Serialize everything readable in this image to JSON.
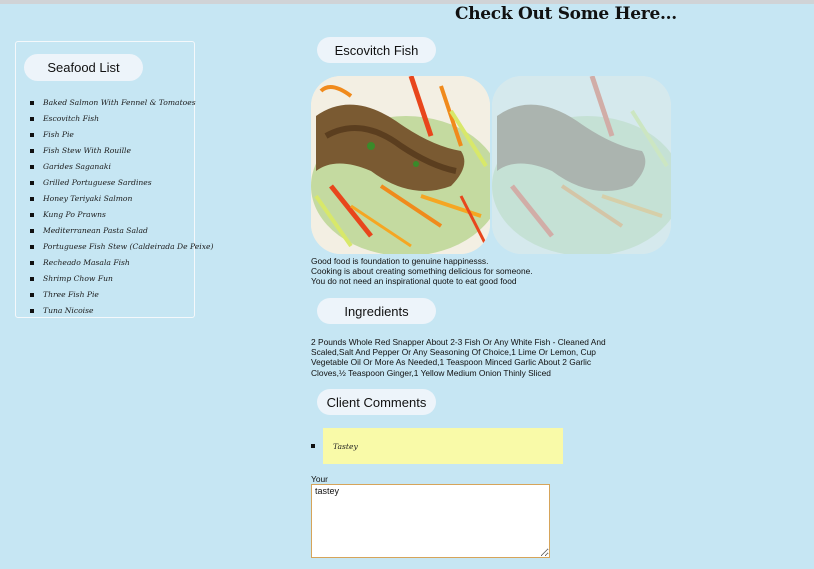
{
  "page": {
    "title": "Check Out Some Here..."
  },
  "sidebar": {
    "heading": "Seafood List",
    "items": [
      "Baked Salmon With Fennel & Tomatoes",
      "Escovitch Fish",
      "Fish Pie",
      "Fish Stew With Rouille",
      "Garides Saganaki",
      "Grilled Portuguese Sardines",
      "Honey Teriyaki Salmon",
      "Kung Po Prawns",
      "Mediterranean Pasta Salad",
      "Portuguese Fish Stew (Caldeirada De Peixe)",
      "Recheado Masala Fish",
      "Shrimp Chow Fun",
      "Three Fish Pie",
      "Tuna Nicoise"
    ]
  },
  "recipe": {
    "name": "Escovitch Fish",
    "quotes": [
      "Good food is foundation to genuine happinesss.",
      "Cooking is about creating something delicious for someone.",
      "You do not need an inspirational quote to eat good food"
    ],
    "ingredients_heading": "Ingredients",
    "ingredients": "2 Pounds Whole Red Snapper About 2-3 Fish Or Any White Fish - Cleaned And Scaled,Salt And Pepper Or Any Seasoning Of Choice,1 Lime Or Lemon, Cup Vegetable Oil Or More As Needed,1 Teaspoon Minced Garlic About 2 Garlic Cloves,½ Teaspoon Ginger,1 Yellow Medium Onion Thinly Sliced"
  },
  "comments": {
    "heading": "Client Comments",
    "items": [
      "Tastey"
    ],
    "form_label": "Your Comment:",
    "textarea_value": "tastey"
  },
  "colors": {
    "background": "#c6e6f3",
    "pill": "#edf4fa",
    "comment_highlight": "#f9faa8",
    "textarea_border": "#d6a45a"
  }
}
